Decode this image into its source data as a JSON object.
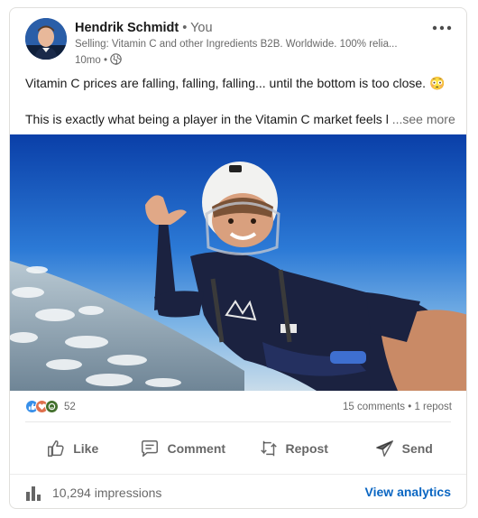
{
  "author": {
    "name": "Hendrik Schmidt",
    "degree": " • You",
    "headline": "Selling: Vitamin C and other Ingredients B2B. Worldwide. 100% relia...",
    "time": "10mo •"
  },
  "post": {
    "line1": "Vitamin C prices are falling, falling, falling... until the bottom is too close.",
    "line1_emoji": "😳",
    "line2": "This is exactly what being a player in the Vitamin C market feels l",
    "see_more": "...see more"
  },
  "social": {
    "reaction_count": "52",
    "comments_reposts": "15 comments • 1 repost"
  },
  "actions": {
    "like": "Like",
    "comment": "Comment",
    "repost": "Repost",
    "send": "Send"
  },
  "footer": {
    "impressions": "10,294 impressions",
    "view_analytics": "View analytics"
  },
  "colors": {
    "link": "#0a66c2",
    "like_reaction": "#378fe9",
    "love_reaction": "#df704d",
    "celebrate_reaction": "#44712e"
  },
  "icons": [
    "more-icon",
    "globe-icon",
    "like-icon",
    "comment-icon",
    "repost-icon",
    "send-icon",
    "bar-chart-icon"
  ]
}
